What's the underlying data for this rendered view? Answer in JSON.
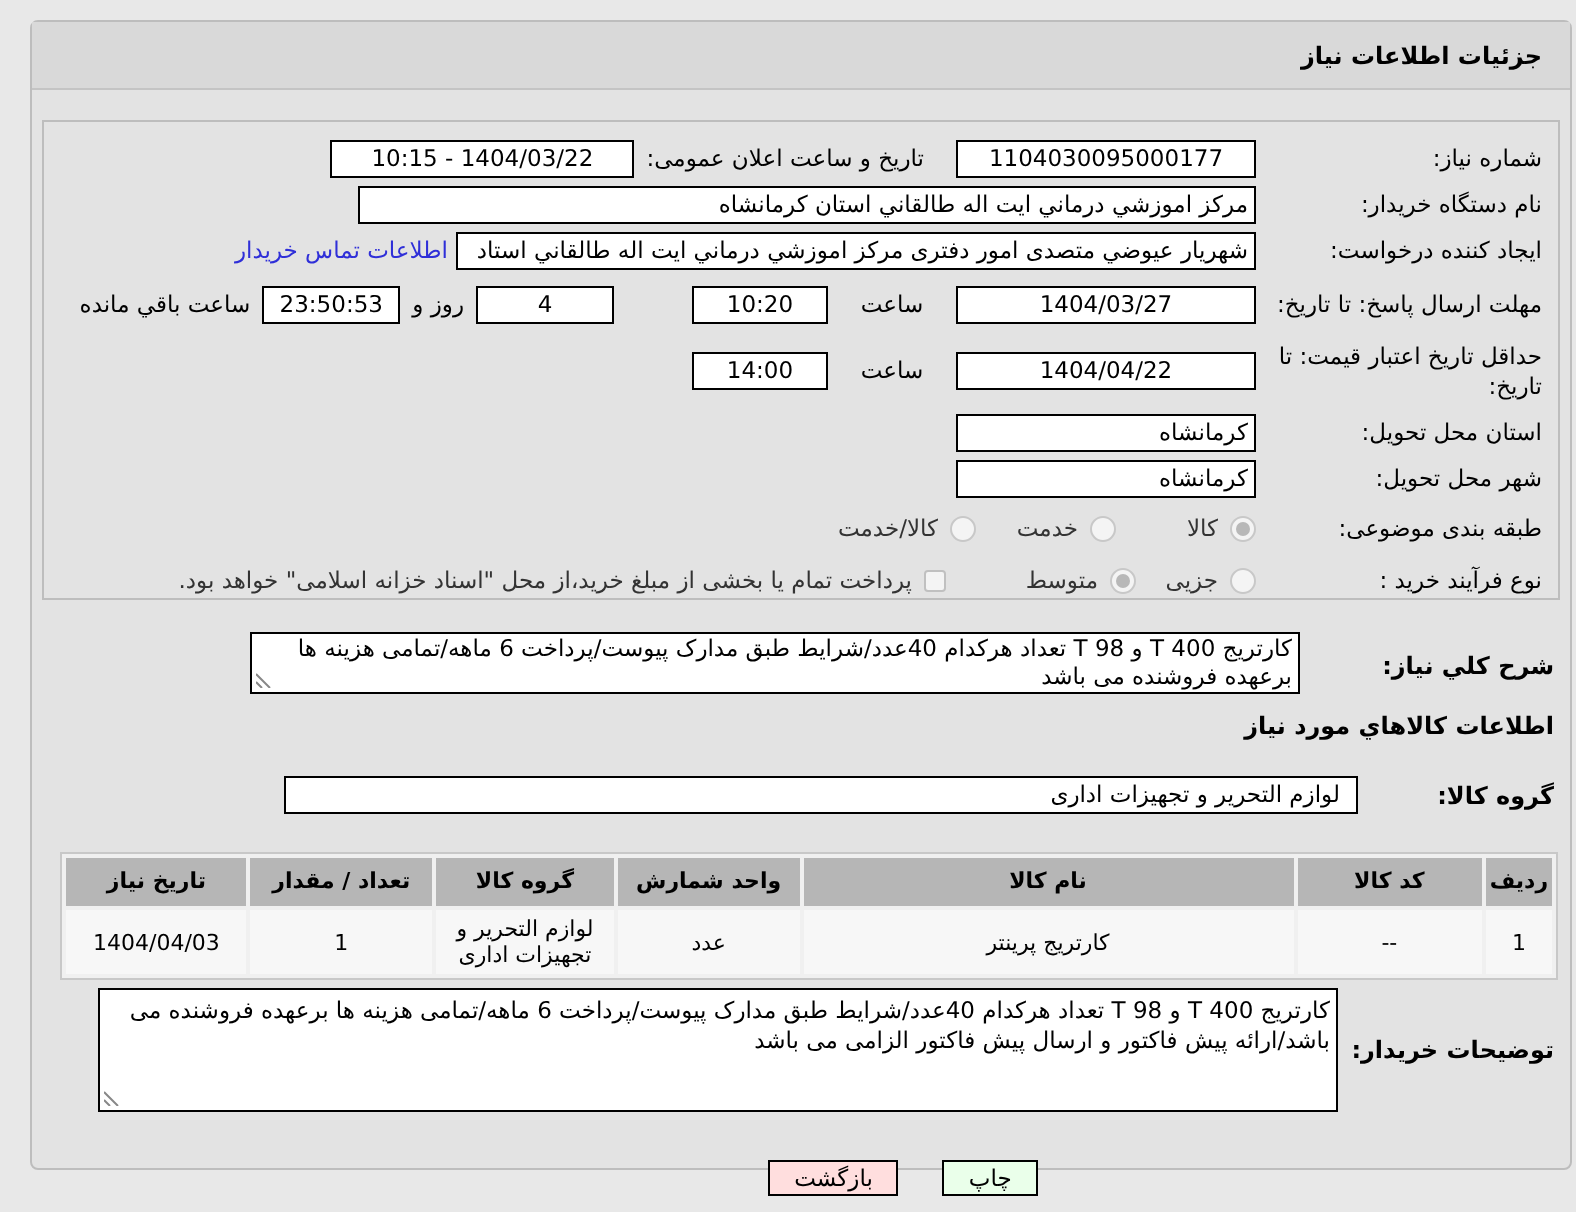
{
  "header": {
    "title": "جزئیات اطلاعات نیاز"
  },
  "need_number": {
    "label": "شماره نیاز:",
    "value": "1104030095000177"
  },
  "announce": {
    "label": "تاریخ و ساعت اعلان عمومی:",
    "value": "1404/03/22 - 10:15"
  },
  "buyer_org": {
    "label": "نام دستگاه خریدار:",
    "value": "مرکز اموزشي درماني ايت اله طالقاني استان كرمانشاه"
  },
  "requester": {
    "label": "ایجاد کننده درخواست:",
    "value": "شهريار عيوضي متصدی امور دفتری مرکز اموزشي درماني ايت اله طالقاني استاد",
    "link": "اطلاعات تماس خریدار"
  },
  "reply_deadline": {
    "label": "مهلت ارسال پاسخ: تا تاریخ:",
    "date": "1404/03/27",
    "time_label": "ساعت",
    "time": "10:20",
    "days": "4",
    "days_suffix": "روز و",
    "remaining": "23:50:53",
    "remaining_suffix": "ساعت باقي مانده"
  },
  "price_validity": {
    "label": "حداقل تاریخ اعتبار قیمت: تا تاریخ:",
    "date": "1404/04/22",
    "time_label": "ساعت",
    "time": "14:00"
  },
  "province": {
    "label": "استان محل تحویل:",
    "value": "کرمانشاه"
  },
  "city": {
    "label": "شهر محل تحویل:",
    "value": "کرمانشاه"
  },
  "category": {
    "label": "طبقه بندی موضوعی:",
    "options": [
      {
        "label": "کالا",
        "selected": true
      },
      {
        "label": "خدمت",
        "selected": false
      },
      {
        "label": "کالا/خدمت",
        "selected": false
      }
    ]
  },
  "process": {
    "label": "نوع فرآیند خرید :",
    "options": [
      {
        "label": "جزیی",
        "selected": false
      },
      {
        "label": "متوسط",
        "selected": true
      }
    ],
    "treasury": {
      "label": "پرداخت تمام یا بخشی از مبلغ خرید،از محل \"اسناد خزانه اسلامی\" خواهد بود.",
      "checked": false
    }
  },
  "description": {
    "label": "شرح کلي نیاز:",
    "value": "کارتریج T 400 و T 98 تعداد هرکدام 40عدد/شرایط طبق مدارک پیوست/پرداخت 6 ماهه/تمامی هزینه ها برعهده فروشنده می باشد"
  },
  "goods_heading": "اطلاعات کالاهاي مورد نياز",
  "goods_group": {
    "label": "گروه کالا:",
    "value": "لوازم التحریر و تجهیزات اداری"
  },
  "table": {
    "columns": [
      "ردیف",
      "کد کالا",
      "نام کالا",
      "واحد شمارش",
      "گروه کالا",
      "تعداد / مقدار",
      "تاریخ نیاز"
    ],
    "rows": [
      [
        "1",
        "--",
        "کارتریج پرینتر",
        "عدد",
        "لوازم التحریر و تجهیزات اداری",
        "1",
        "1404/04/03"
      ]
    ]
  },
  "buyer_notes": {
    "label": "توضیحات خریدار:",
    "value": "کارتریج T 400 و T 98 تعداد هرکدام 40عدد/شرایط طبق مدارک پیوست/پرداخت 6 ماهه/تمامی هزینه ها برعهده فروشنده می باشد/ارائه پیش فاکتور و ارسال پیش فاکتور الزامی می باشد"
  },
  "buttons": [
    {
      "label": "چاپ",
      "kind": "print"
    },
    {
      "label": "بازگشت",
      "kind": "back"
    }
  ]
}
